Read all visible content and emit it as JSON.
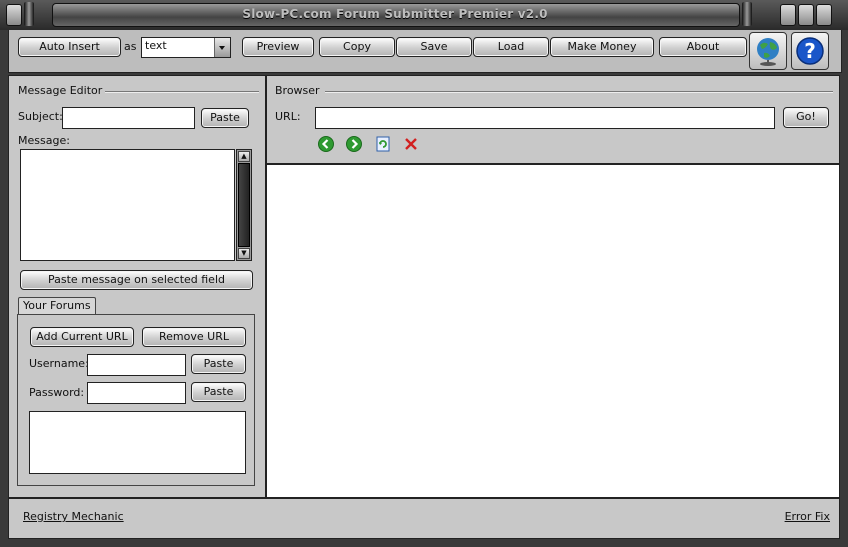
{
  "window": {
    "title": "Slow-PC.com Forum Submitter Premier v2.0"
  },
  "toolbar": {
    "auto_insert_label": "Auto Insert",
    "as_label": "as",
    "format_value": "text",
    "buttons": [
      "Preview",
      "Copy",
      "Save",
      "Load",
      "Make Money",
      "About"
    ],
    "globe_icon": "globe-icon",
    "help_icon": "help-icon"
  },
  "message_editor": {
    "legend": "Message Editor",
    "subject_label": "Subject:",
    "subject_value": "",
    "paste_label": "Paste",
    "message_label": "Message:",
    "message_value": "",
    "paste_selected_label": "Paste message on selected field"
  },
  "forums": {
    "tab_label": "Your Forums",
    "add_url_label": "Add Current URL",
    "remove_url_label": "Remove URL",
    "username_label": "Username:",
    "username_value": "",
    "password_label": "Password:",
    "password_value": "",
    "paste_label": "Paste"
  },
  "browser": {
    "legend": "Browser",
    "url_label": "URL:",
    "url_value": "",
    "go_label": "Go!",
    "nav_icons": [
      "back-icon",
      "forward-icon",
      "refresh-icon",
      "stop-icon"
    ]
  },
  "status": {
    "left_link": "Registry Mechanic",
    "right_link": "Error Fix"
  }
}
